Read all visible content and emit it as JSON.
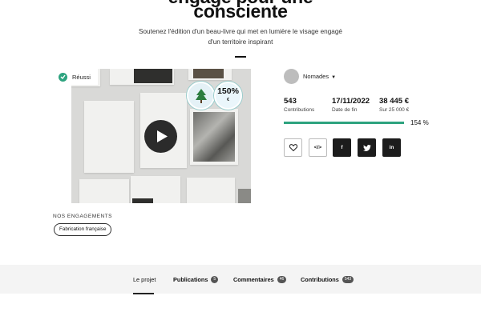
{
  "header": {
    "title_line1": "engagé pour une",
    "title_line2": "consciente",
    "subtitle": "Soutenez l'édition d'un beau-livre qui met en lumière le visage engagé d'un territoire inspirant"
  },
  "media": {
    "status": "Réussi",
    "badge_percent": "150%",
    "badge_percent_symbol": "€",
    "play_icon": "play-icon"
  },
  "engagements": {
    "label": "NOS ENGAGEMENTS",
    "tags": [
      "Fabrication française"
    ]
  },
  "owner": {
    "name": "Nomades"
  },
  "stats": {
    "contributions_value": "543",
    "contributions_label": "Contributions",
    "end_date_value": "17/11/2022",
    "end_date_label": "Date de fin",
    "amount_value": "38 445 €",
    "amount_label": "Sur 25 000 €",
    "progress_percent": 100,
    "progress_text": "154 %"
  },
  "share": {
    "buttons": [
      "heart-icon",
      "embed-icon",
      "facebook-icon",
      "twitter-icon",
      "linkedin-icon"
    ],
    "facebook": "f",
    "linkedin": "in",
    "embed": "</>"
  },
  "tabs": [
    {
      "label": "Le projet"
    },
    {
      "label": "Publications",
      "count": "5"
    },
    {
      "label": "Commentaires",
      "count": "46"
    },
    {
      "label": "Contributions",
      "count": "543"
    }
  ],
  "colors": {
    "accent": "#2da37f",
    "dark": "#1c1c1c"
  }
}
